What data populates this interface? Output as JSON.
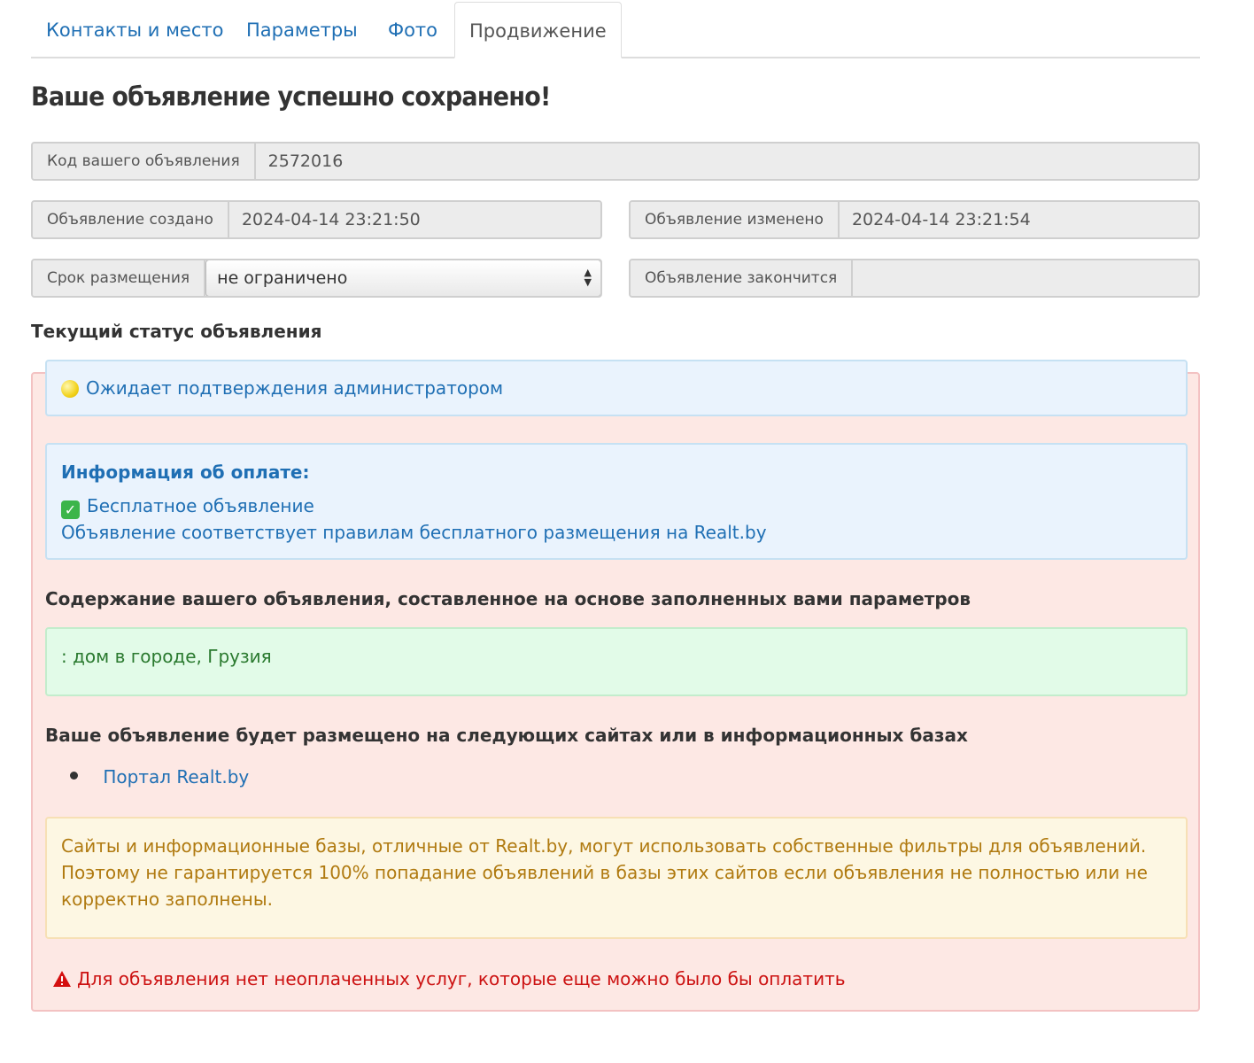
{
  "tabs": [
    {
      "label": "Контакты и место",
      "active": false
    },
    {
      "label": "Параметры",
      "active": false
    },
    {
      "label": "Фото",
      "active": false
    },
    {
      "label": "Продвижение",
      "active": true
    }
  ],
  "page_title": "Ваше объявление успешно сохранено!",
  "fields": {
    "ad_code": {
      "label": "Код вашего объявления",
      "value": "2572016"
    },
    "created": {
      "label": "Объявление создано",
      "value": "2024-04-14 23:21:50"
    },
    "modified": {
      "label": "Объявление изменено",
      "value": "2024-04-14 23:21:54"
    },
    "term": {
      "label": "Срок размещения",
      "value": "не ограничено"
    },
    "ends": {
      "label": "Объявление закончится",
      "value": ""
    }
  },
  "status": {
    "heading": "Текущий статус объявления",
    "state_text": "Ожидает подтверждения администратором",
    "state_icon": "yellow-circle-icon"
  },
  "payment": {
    "title": "Информация об оплате:",
    "type": "Бесплатное объявление",
    "type_icon": "green-check-icon",
    "note": "Объявление соответствует правилам бесплатного размещения на Realt.by"
  },
  "content": {
    "heading": "Содержание вашего объявления, составленное на основе заполненных вами параметров",
    "text": ": дом в городе, Грузия"
  },
  "sites": {
    "heading": "Ваше объявление будет размещено на следующих сайтах или в информационных базах",
    "items": [
      "Портал Realt.by"
    ]
  },
  "warning": {
    "lines": [
      "Сайты и информационные базы, отличные от Realt.by, могут использовать собственные фильтры для объявлений.",
      "Поэтому не гарантируется 100% попадание объявлений в базы этих сайтов если объявления не полностью или не",
      "корректно заполнены."
    ]
  },
  "unpaid_notice": {
    "text": "Для объявления нет неоплаченных услуг, которые еще можно было бы оплатить",
    "icon": "warning-triangle-icon"
  },
  "colors": {
    "link": "#1f6fb4",
    "danger": "#cc1111",
    "panel_bg": "#fde8e4"
  }
}
